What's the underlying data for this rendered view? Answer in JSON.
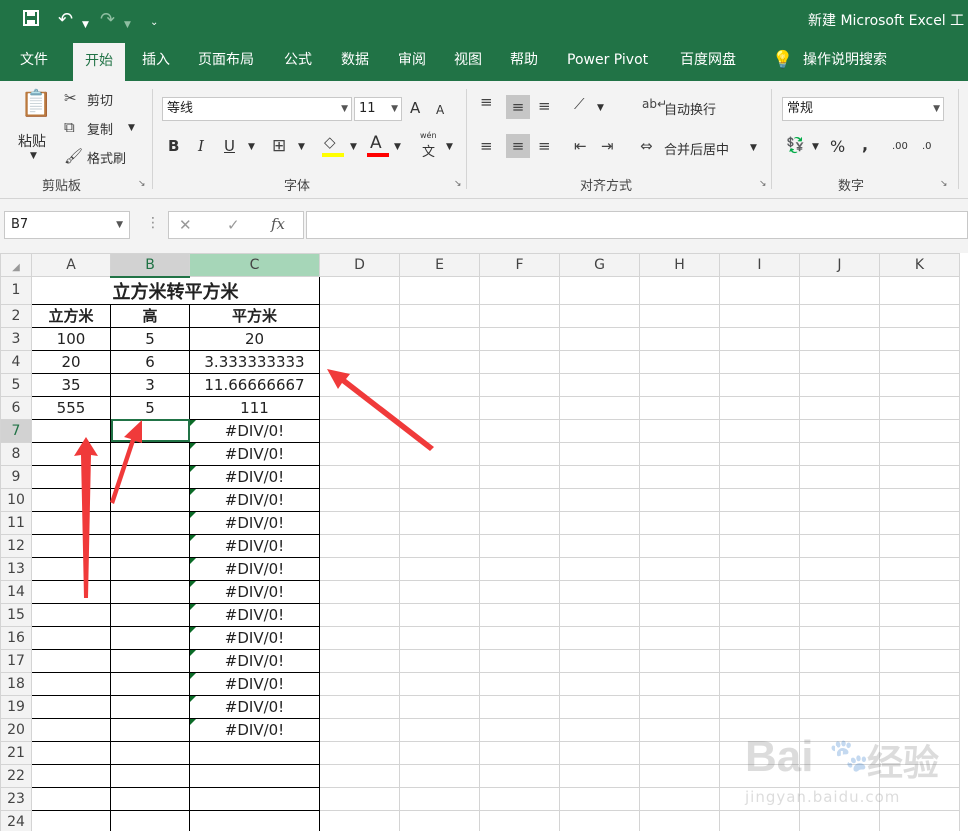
{
  "titlebar": {
    "title": "新建 Microsoft Excel 工"
  },
  "tabs": [
    "文件",
    "开始",
    "插入",
    "页面布局",
    "公式",
    "数据",
    "审阅",
    "视图",
    "帮助",
    "Power Pivot",
    "百度网盘"
  ],
  "active_tab": "开始",
  "tell_me": "操作说明搜索",
  "ribbon": {
    "clipboard": {
      "paste": "粘贴",
      "cut": "剪切",
      "copy": "复制",
      "format_painter": "格式刷",
      "label": "剪贴板"
    },
    "font": {
      "name": "等线",
      "size": "11",
      "label": "字体",
      "bold": "B",
      "italic": "I",
      "underline": "U",
      "grow": "A",
      "shrink": "A",
      "color_a": "A",
      "phonetic_top": "wén",
      "phonetic_bottom": "文"
    },
    "alignment": {
      "wrap": "自动换行",
      "merge": "合并后居中",
      "label": "对齐方式"
    },
    "number": {
      "format": "常规",
      "label": "数字",
      "percent": "%",
      "comma": ",",
      "inc_dec": ".00",
      "dec_dec": ".0"
    },
    "colors": {
      "fill": "#ffff00",
      "font": "#ff0000",
      "accent": "#217346"
    }
  },
  "formula_bar": {
    "name_box": "B7",
    "cancel": "✕",
    "enter": "✓",
    "fx": "fx",
    "value": ""
  },
  "columns": [
    "A",
    "B",
    "C",
    "D",
    "E",
    "F",
    "G",
    "H",
    "I",
    "J",
    "K"
  ],
  "rows": [
    "1",
    "2",
    "3",
    "4",
    "5",
    "6",
    "7",
    "8",
    "9",
    "10",
    "11",
    "12",
    "13",
    "14",
    "15",
    "16",
    "17",
    "18",
    "19",
    "20",
    "21",
    "22",
    "23",
    "24"
  ],
  "sheet": {
    "title": "立方米转平方米",
    "headers": [
      "立方米",
      "高",
      "平方米"
    ],
    "data": [
      [
        "100",
        "5",
        "20"
      ],
      [
        "20",
        "6",
        "3.333333333"
      ],
      [
        "35",
        "3",
        "11.66666667"
      ],
      [
        "555",
        "5",
        "111"
      ]
    ],
    "error_value": "#DIV/0!"
  },
  "watermark": {
    "brand": "Bai",
    "brand2": "du",
    "cn": "经验",
    "url": "jingyan.baidu.com"
  }
}
